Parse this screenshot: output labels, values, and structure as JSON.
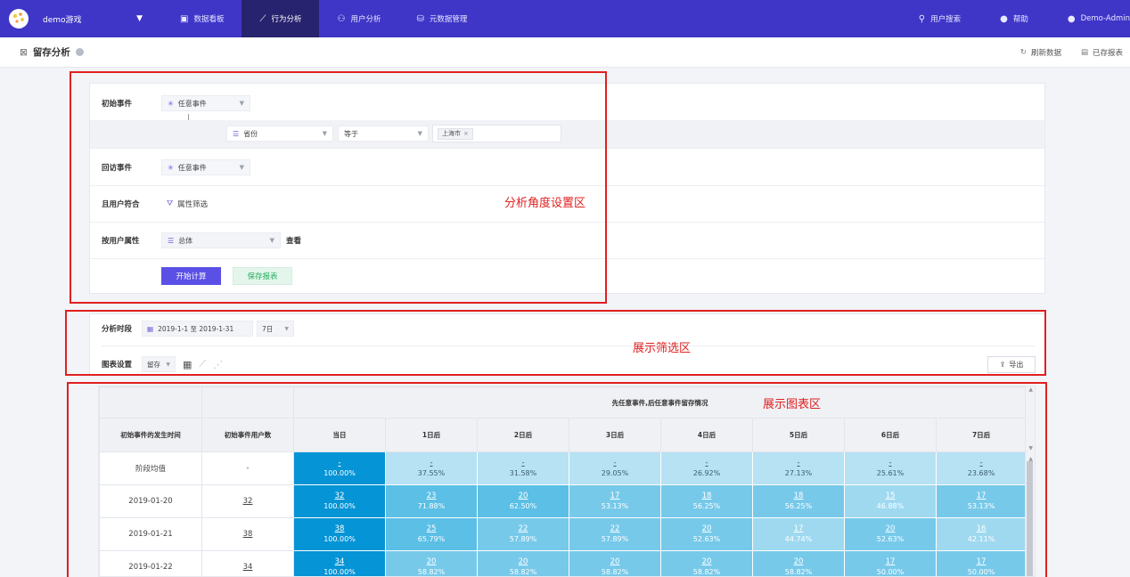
{
  "topnav": {
    "project": "demo游戏",
    "items": [
      {
        "label": "数据看板",
        "icon": "dashboard-icon"
      },
      {
        "label": "行为分析",
        "icon": "line-chart-icon",
        "active": true
      },
      {
        "label": "用户分析",
        "icon": "user-icon"
      },
      {
        "label": "元数据管理",
        "icon": "database-icon"
      }
    ],
    "right": [
      {
        "label": "用户搜索",
        "icon": "search-icon"
      },
      {
        "label": "帮助",
        "icon": "help-icon"
      },
      {
        "label": "Demo-Admin",
        "icon": "account-icon"
      }
    ]
  },
  "subheader": {
    "title": "留存分析",
    "refresh": "刷新数据",
    "saved_reports": "已存报表"
  },
  "config": {
    "initial_event_label": "初始事件",
    "initial_event_value": "任意事件",
    "filter_property": "省份",
    "filter_operator": "等于",
    "filter_tag": "上海市",
    "return_event_label": "回访事件",
    "return_event_value": "任意事件",
    "user_match_label": "且用户符合",
    "property_filter": "属性筛选",
    "group_by_label": "按用户属性",
    "group_by_value": "总体",
    "view": "查看",
    "calculate_button": "开始计算",
    "save_button": "保存报表"
  },
  "filter": {
    "period_label": "分析时段",
    "period_value": "2019-1-1 至 2019-1-31",
    "period_days": "7日",
    "chart_settings_label": "图表设置",
    "chart_type": "留存",
    "export": "导出"
  },
  "table": {
    "group_header": "先任意事件,后任意事件留存情况",
    "col_time": "初始事件的发生时间",
    "col_users": "初始事件用户数",
    "days": [
      "当日",
      "1日后",
      "2日后",
      "3日后",
      "4日后",
      "5日后",
      "6日后",
      "7日后"
    ],
    "rows": [
      {
        "date": "阶段均值",
        "users": "-",
        "cells": [
          {
            "count": "-",
            "pct": "100.00%"
          },
          {
            "count": "-",
            "pct": "37.55%"
          },
          {
            "count": "-",
            "pct": "31.58%"
          },
          {
            "count": "-",
            "pct": "29.05%"
          },
          {
            "count": "-",
            "pct": "26.92%"
          },
          {
            "count": "-",
            "pct": "27.13%"
          },
          {
            "count": "-",
            "pct": "25.61%"
          },
          {
            "count": "-",
            "pct": "23.68%"
          }
        ]
      },
      {
        "date": "2019-01-20",
        "users": "32",
        "cells": [
          {
            "count": "32",
            "pct": "100.00%"
          },
          {
            "count": "23",
            "pct": "71.88%"
          },
          {
            "count": "20",
            "pct": "62.50%"
          },
          {
            "count": "17",
            "pct": "53.13%"
          },
          {
            "count": "18",
            "pct": "56.25%"
          },
          {
            "count": "18",
            "pct": "56.25%"
          },
          {
            "count": "15",
            "pct": "46.88%"
          },
          {
            "count": "17",
            "pct": "53.13%"
          }
        ]
      },
      {
        "date": "2019-01-21",
        "users": "38",
        "cells": [
          {
            "count": "38",
            "pct": "100.00%"
          },
          {
            "count": "25",
            "pct": "65.79%"
          },
          {
            "count": "22",
            "pct": "57.89%"
          },
          {
            "count": "22",
            "pct": "57.89%"
          },
          {
            "count": "20",
            "pct": "52.63%"
          },
          {
            "count": "17",
            "pct": "44.74%"
          },
          {
            "count": "20",
            "pct": "52.63%"
          },
          {
            "count": "16",
            "pct": "42.11%"
          }
        ]
      },
      {
        "date": "2019-01-22",
        "users": "34",
        "cells": [
          {
            "count": "34",
            "pct": "100.00%"
          },
          {
            "count": "20",
            "pct": "58.82%"
          },
          {
            "count": "20",
            "pct": "58.82%"
          },
          {
            "count": "20",
            "pct": "58.82%"
          },
          {
            "count": "20",
            "pct": "58.82%"
          },
          {
            "count": "20",
            "pct": "58.82%"
          },
          {
            "count": "17",
            "pct": "50.00%"
          },
          {
            "count": "17",
            "pct": "50.00%"
          }
        ]
      }
    ]
  },
  "annotations": {
    "config_area": "分析角度设置区",
    "filter_area": "展示筛选区",
    "chart_area": "展示图表区"
  },
  "colors": {
    "nav_bg": "#3f36c8",
    "nav_active": "#28236e",
    "primary": "#5a50e6",
    "day0": "#0594d5",
    "annotation": "#e02020"
  }
}
